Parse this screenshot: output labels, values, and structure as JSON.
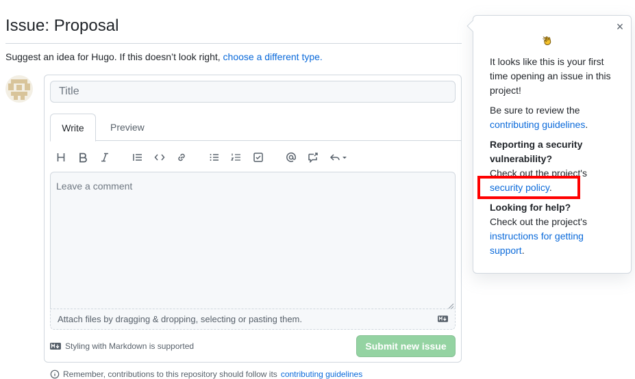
{
  "page": {
    "title": "Issue: Proposal",
    "subtitle_text": "Suggest an idea for Hugo. If this doesn’t look right,",
    "subtitle_link": "choose a different type."
  },
  "form": {
    "title_placeholder": "Title",
    "tabs": [
      "Write",
      "Preview"
    ],
    "toolbar_icons": [
      "heading-icon",
      "bold-icon",
      "italic-icon",
      "quote-icon",
      "code-icon",
      "link-icon",
      "bulleted-list-icon",
      "numbered-list-icon",
      "task-list-icon",
      "mention-icon",
      "reference-icon",
      "saved-replies-icon"
    ],
    "comment_placeholder": "Leave a comment",
    "attach_text": "Attach files by dragging & dropping, selecting or pasting them.",
    "markdown_note": "Styling with Markdown is supported",
    "submit_label": "Submit new issue",
    "footer_note_text": "Remember, contributions to this repository should follow its",
    "footer_note_link": "contributing guidelines"
  },
  "popover": {
    "close_label": "×",
    "intro": "It looks like this is your first time opening an issue in this project!",
    "review_text": "Be sure to review the",
    "review_link": "contributing guidelines",
    "review_end": ".",
    "security_heading": "Reporting a security vulnerability?",
    "security_text": "Check out the project's",
    "security_link": "security policy",
    "security_end": ".",
    "help_heading": "Looking for help?",
    "help_text": "Check out the project's",
    "help_link": "instructions for getting support",
    "help_end": "."
  },
  "colors": {
    "link": "#0969da",
    "submit_disabled": "#94d3a2",
    "highlight": "#ff0000",
    "border": "#d0d7de"
  }
}
